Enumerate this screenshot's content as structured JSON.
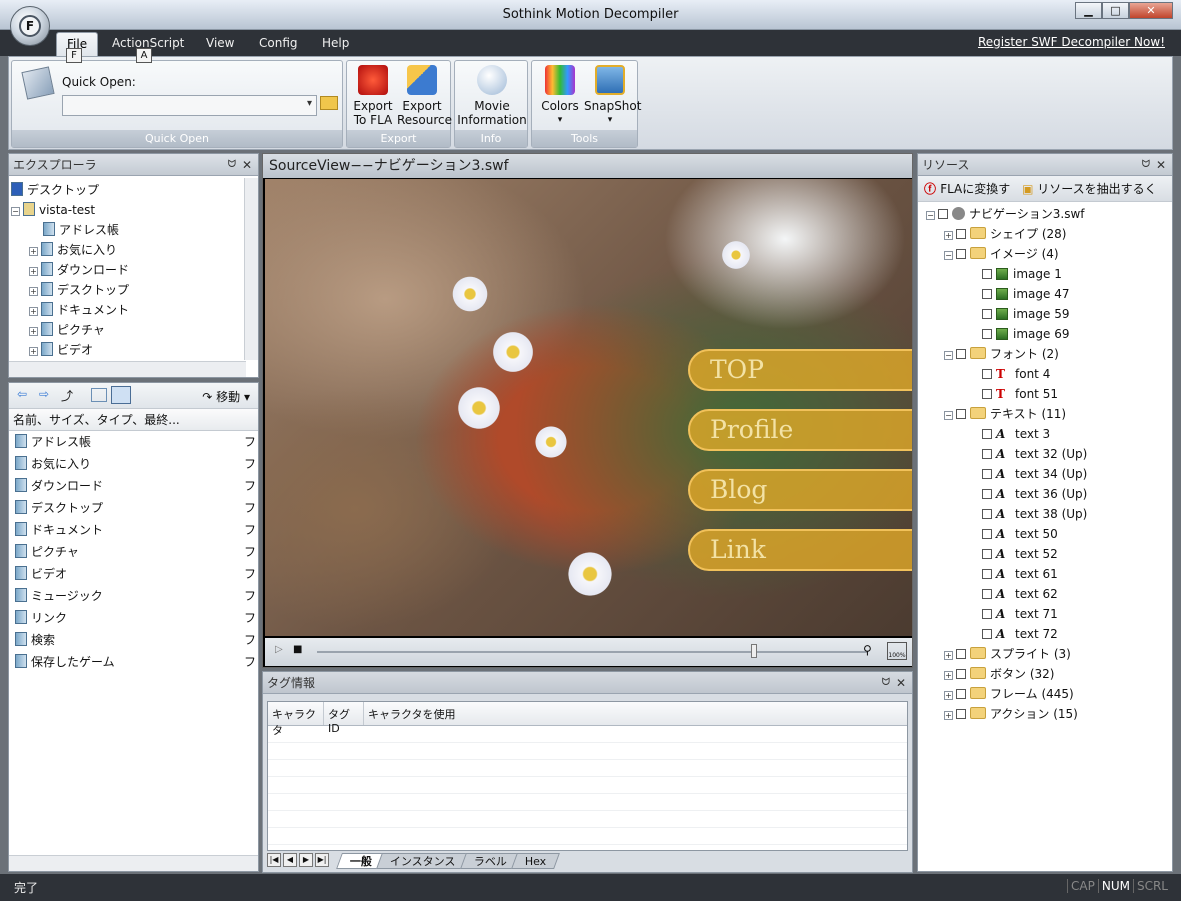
{
  "window": {
    "title": "Sothink Motion Decompiler",
    "min": "▁",
    "max": "□",
    "close": "✕"
  },
  "app_button": {
    "glyph": "F"
  },
  "menu": {
    "items": [
      "File",
      "ActionScript",
      "View",
      "Config",
      "Help"
    ],
    "keytips": [
      "F",
      "A"
    ],
    "register": "Register SWF Decompiler Now!"
  },
  "ribbon": {
    "quick_open": {
      "label": "Quick Open:",
      "group": "Quick Open",
      "value": ""
    },
    "export": {
      "group": "Export",
      "to_fla": "Export\nTo FLA",
      "to_fla_1": "Export",
      "to_fla_2": "To FLA",
      "res_1": "Export",
      "res_2": "Resource"
    },
    "info": {
      "group": "Info",
      "movie_1": "Movie",
      "movie_2": "Information"
    },
    "tools": {
      "group": "Tools",
      "colors": "Colors",
      "snapshot": "SnapShot",
      "arrow": "▾"
    }
  },
  "explorer": {
    "title": "エクスプローラ",
    "tree": [
      {
        "label": "デスクトップ",
        "level": 0
      },
      {
        "label": "vista-test",
        "level": 0
      },
      {
        "label": "アドレス帳",
        "level": 1
      },
      {
        "label": "お気に入り",
        "level": 1
      },
      {
        "label": "ダウンロード",
        "level": 1
      },
      {
        "label": "デスクトップ",
        "level": 1
      },
      {
        "label": "ドキュメント",
        "level": 1
      },
      {
        "label": "ピクチャ",
        "level": 1
      },
      {
        "label": "ビデオ",
        "level": 1
      }
    ],
    "move_label": "移動",
    "column_header": "名前、サイズ、タイプ、最終...",
    "list": [
      "アドレス帳",
      "お気に入り",
      "ダウンロード",
      "デスクトップ",
      "ドキュメント",
      "ピクチャ",
      "ビデオ",
      "ミュージック",
      "リンク",
      "検索",
      "保存したゲーム"
    ],
    "list_type": "フ"
  },
  "viewer": {
    "title": "SourceView−−ナビゲーション3.swf",
    "buttons": [
      "TOP",
      "Profile",
      "Blog",
      "Link"
    ],
    "zoom_label": "100%"
  },
  "tag_info": {
    "title": "タグ情報",
    "columns": [
      "キャラクタ",
      "タグID",
      "キャラクタを使用"
    ],
    "tabs": [
      "一般",
      "インスタンス",
      "ラベル",
      "Hex"
    ]
  },
  "resources": {
    "title": "リソース",
    "convert": "FLAに変換す",
    "extract": "リソースを抽出するく",
    "root": "ナビゲーション3.swf",
    "items": [
      {
        "label": "シェイプ (28)",
        "kind": "folder",
        "level": 1,
        "exp": "+"
      },
      {
        "label": "イメージ (4)",
        "kind": "folder",
        "level": 1,
        "exp": "−"
      },
      {
        "label": "image 1",
        "kind": "image",
        "level": 2
      },
      {
        "label": "image 47",
        "kind": "image",
        "level": 2
      },
      {
        "label": "image 59",
        "kind": "image",
        "level": 2
      },
      {
        "label": "image 69",
        "kind": "image",
        "level": 2
      },
      {
        "label": "フォント (2)",
        "kind": "folder",
        "level": 1,
        "exp": "−"
      },
      {
        "label": "font 4",
        "kind": "font",
        "level": 2
      },
      {
        "label": "font 51",
        "kind": "font",
        "level": 2
      },
      {
        "label": "テキスト (11)",
        "kind": "folder",
        "level": 1,
        "exp": "−"
      },
      {
        "label": "text 3",
        "kind": "text",
        "level": 2
      },
      {
        "label": "text 32 (Up)",
        "kind": "text",
        "level": 2
      },
      {
        "label": "text 34 (Up)",
        "kind": "text",
        "level": 2
      },
      {
        "label": "text 36 (Up)",
        "kind": "text",
        "level": 2
      },
      {
        "label": "text 38 (Up)",
        "kind": "text",
        "level": 2
      },
      {
        "label": "text 50",
        "kind": "text",
        "level": 2
      },
      {
        "label": "text 52",
        "kind": "text",
        "level": 2
      },
      {
        "label": "text 61",
        "kind": "text",
        "level": 2
      },
      {
        "label": "text 62",
        "kind": "text",
        "level": 2
      },
      {
        "label": "text 71",
        "kind": "text",
        "level": 2
      },
      {
        "label": "text 72",
        "kind": "text",
        "level": 2
      },
      {
        "label": "スプライト (3)",
        "kind": "folder",
        "level": 1,
        "exp": "+"
      },
      {
        "label": "ボタン (32)",
        "kind": "folder",
        "level": 1,
        "exp": "+"
      },
      {
        "label": "フレーム (445)",
        "kind": "folder",
        "level": 1,
        "exp": "+"
      },
      {
        "label": "アクション (15)",
        "kind": "folder",
        "level": 1,
        "exp": "+"
      }
    ]
  },
  "status": {
    "text": "完了",
    "caps": "CAP",
    "num": "NUM",
    "scrl": "SCRL"
  }
}
